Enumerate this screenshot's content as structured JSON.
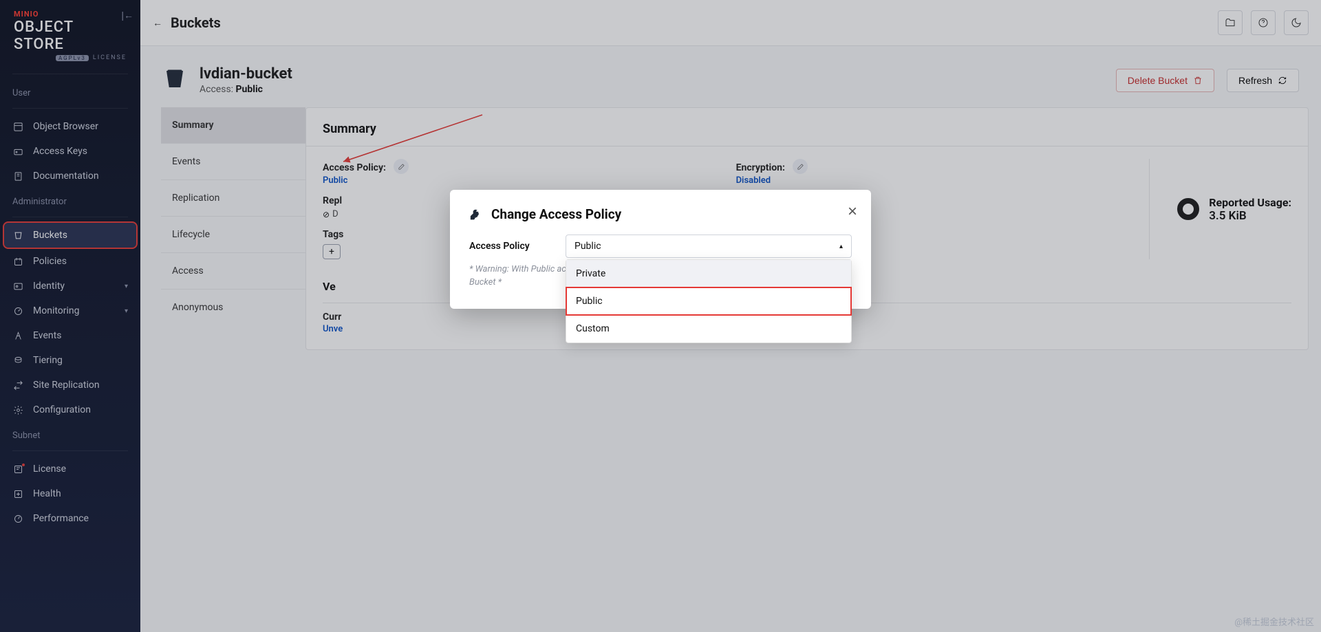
{
  "logo": {
    "brand": "MINIO",
    "title": "OBJECT STORE",
    "badge": "AGPLv3",
    "sub": "LICENSE"
  },
  "sidebar": {
    "sections": [
      {
        "title": "User",
        "items": [
          {
            "key": "object-browser",
            "label": "Object Browser"
          },
          {
            "key": "access-keys",
            "label": "Access Keys"
          },
          {
            "key": "documentation",
            "label": "Documentation"
          }
        ]
      },
      {
        "title": "Administrator",
        "items": [
          {
            "key": "buckets",
            "label": "Buckets",
            "active": true
          },
          {
            "key": "policies",
            "label": "Policies"
          },
          {
            "key": "identity",
            "label": "Identity",
            "expands": true
          },
          {
            "key": "monitoring",
            "label": "Monitoring",
            "expands": true
          },
          {
            "key": "events",
            "label": "Events"
          },
          {
            "key": "tiering",
            "label": "Tiering"
          },
          {
            "key": "site-replication",
            "label": "Site Replication"
          },
          {
            "key": "configuration",
            "label": "Configuration"
          }
        ]
      },
      {
        "title": "Subnet",
        "items": [
          {
            "key": "license",
            "label": "License"
          },
          {
            "key": "health",
            "label": "Health"
          },
          {
            "key": "performance",
            "label": "Performance"
          }
        ]
      }
    ]
  },
  "breadcrumb": {
    "back": "←",
    "label": "Buckets"
  },
  "head": {
    "title": "lvdian-bucket",
    "access_prefix": "Access: ",
    "access_value": "Public",
    "delete": "Delete Bucket",
    "refresh": "Refresh"
  },
  "subnav": [
    {
      "key": "summary",
      "label": "Summary",
      "active": true
    },
    {
      "key": "events",
      "label": "Events"
    },
    {
      "key": "replication",
      "label": "Replication"
    },
    {
      "key": "lifecycle",
      "label": "Lifecycle"
    },
    {
      "key": "access",
      "label": "Access"
    },
    {
      "key": "anonymous",
      "label": "Anonymous"
    }
  ],
  "summary": {
    "title": "Summary",
    "access_policy_label": "Access Policy:",
    "access_policy_value": "Public",
    "encryption_label": "Encryption:",
    "encryption_value": "Disabled",
    "replication_label": "Repl",
    "replication_disabled": "D",
    "tags_label": "Tags",
    "usage_label": "Reported Usage:",
    "usage_value": "3.5 KiB",
    "versioning_title": "Ve",
    "current_status_label": "Curr",
    "current_status_value": "Unve"
  },
  "modal": {
    "title": "Change Access Policy",
    "field_label": "Access Policy",
    "selected": "Public",
    "options": [
      "Private",
      "Public",
      "Custom"
    ],
    "note": "* Warning: With Public access anyone will be able to upload, download and delete files from this Bucket *"
  },
  "watermark": "@稀土掘金技术社区"
}
